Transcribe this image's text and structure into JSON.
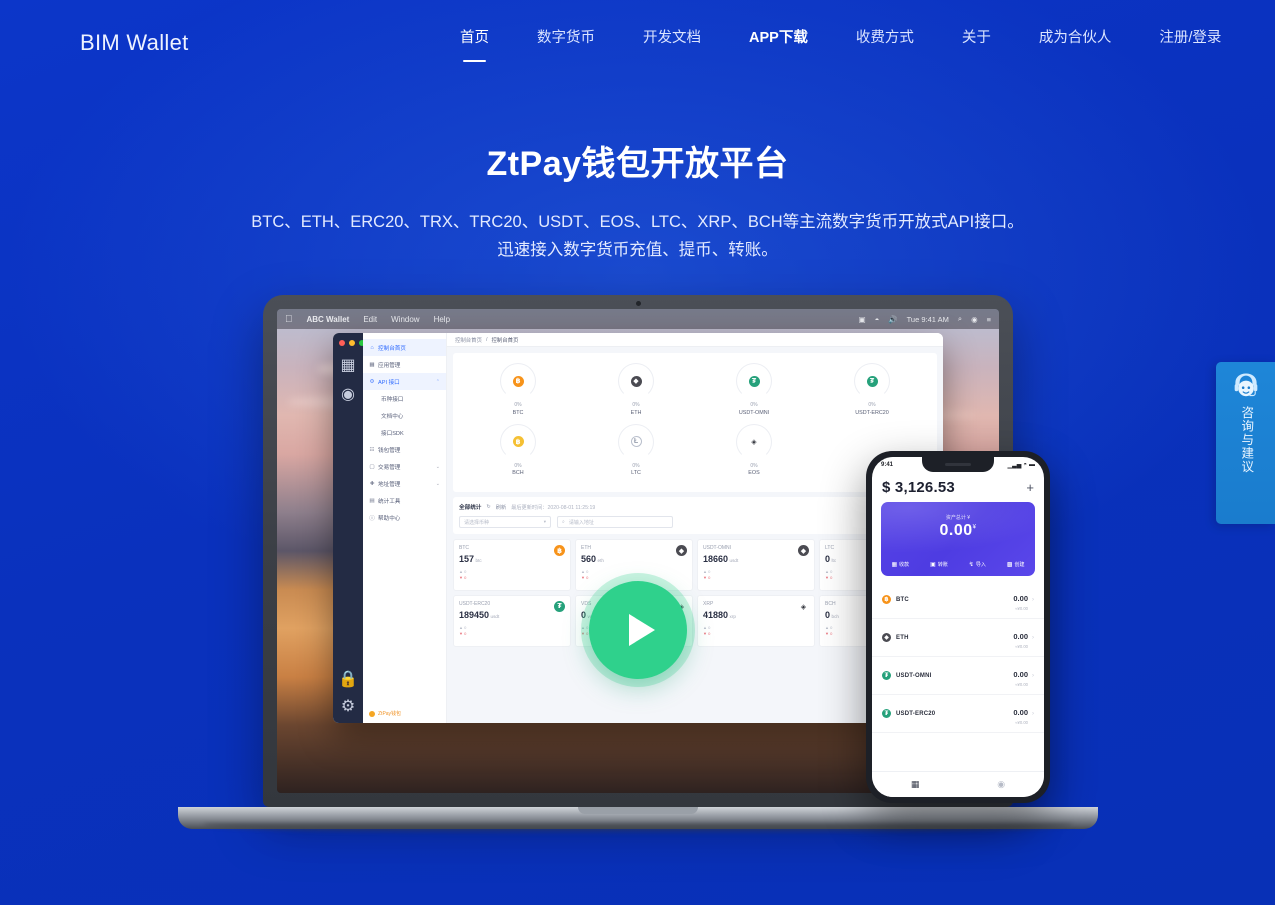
{
  "header": {
    "brand": "BIM Wallet",
    "nav": [
      {
        "label": "首页",
        "state": "active"
      },
      {
        "label": "数字货币",
        "state": "normal"
      },
      {
        "label": "开发文档",
        "state": "normal"
      },
      {
        "label": "APP下载",
        "state": "bold"
      },
      {
        "label": "收费方式",
        "state": "normal"
      },
      {
        "label": "关于",
        "state": "normal"
      },
      {
        "label": "成为合伙人",
        "state": "normal"
      },
      {
        "label": "注册/登录",
        "state": "normal"
      }
    ]
  },
  "hero": {
    "title": "ZtPay钱包开放平台",
    "sub_line1": "BTC、ETH、ERC20、TRX、TRC20、USDT、EOS、LTC、XRP、BCH等主流数字货币开放式API接口。",
    "sub_line2": "迅速接入数字货币充值、提币、转账。"
  },
  "play_button": {
    "name": "play-video-button"
  },
  "consult_widget": {
    "icon": "headset-support-icon",
    "text": "咨询与建议"
  },
  "laptop": {
    "macos_menubar": {
      "apple": "",
      "items": [
        "ABC Wallet",
        "Edit",
        "Window",
        "Help"
      ],
      "right": [
        "screen-icon",
        "wifi-icon",
        "volume-icon",
        "Tue 9:41 AM",
        "search-icon",
        "siri-icon",
        "controlcenter-icon"
      ]
    },
    "app": {
      "sidebar": [
        {
          "label": "控制台首页",
          "icon": "home-icon",
          "selected": true,
          "sub": false,
          "chevron": ""
        },
        {
          "label": "应用管理",
          "icon": "apps-icon",
          "selected": false,
          "sub": false,
          "chevron": ""
        },
        {
          "label": "API 接口",
          "icon": "api-icon",
          "selected": false,
          "sub": false,
          "chevron": "⌃",
          "highlight": true
        },
        {
          "label": "币种接口",
          "icon": "",
          "selected": false,
          "sub": true,
          "chevron": ""
        },
        {
          "label": "文档中心",
          "icon": "",
          "selected": false,
          "sub": true,
          "chevron": ""
        },
        {
          "label": "接口SDK",
          "icon": "",
          "selected": false,
          "sub": true,
          "chevron": ""
        },
        {
          "label": "钱包管理",
          "icon": "wallet-icon",
          "selected": false,
          "sub": false,
          "chevron": ""
        },
        {
          "label": "交易管理",
          "icon": "tx-icon",
          "selected": false,
          "sub": false,
          "chevron": "⌄"
        },
        {
          "label": "地址管理",
          "icon": "addr-icon",
          "selected": false,
          "sub": false,
          "chevron": "⌄"
        },
        {
          "label": "统计工具",
          "icon": "chart-icon",
          "selected": false,
          "sub": false,
          "chevron": ""
        },
        {
          "label": "帮助中心",
          "icon": "help-icon",
          "selected": false,
          "sub": false,
          "chevron": ""
        }
      ],
      "sidebar_logo": "ZtPay钱包",
      "breadcrumb": {
        "root": "控制台首页",
        "sep": "/",
        "current": "控制台首页"
      },
      "coin_gauges": [
        {
          "symbol": "BTC",
          "percent": "0%",
          "glyph": "฿",
          "style": "cb-btc"
        },
        {
          "symbol": "ETH",
          "percent": "0%",
          "glyph": "◆",
          "style": "cb-eth"
        },
        {
          "symbol": "USDT-OMNI",
          "percent": "0%",
          "glyph": "₮",
          "style": "cb-usdt"
        },
        {
          "symbol": "USDT-ERC20",
          "percent": "0%",
          "glyph": "₮",
          "style": "cb-usdt"
        },
        {
          "symbol": "BCH",
          "percent": "0%",
          "glyph": "฿",
          "style": "cb-bch"
        },
        {
          "symbol": "LTC",
          "percent": "0%",
          "glyph": "Ł",
          "style": "cb-ltc"
        },
        {
          "symbol": "EOS",
          "percent": "0%",
          "glyph": "◈",
          "style": "cb-eos"
        }
      ],
      "filter": {
        "title": "全部统计",
        "refresh": "刷新",
        "updated": "最后更新时间：2020-08-01 11:25:19",
        "select_placeholder": "请选择币种",
        "input_placeholder": "请输入地址",
        "search_icon": "search-icon"
      },
      "wallet_cards": [
        {
          "name": "BTC",
          "amount": "157",
          "unit": "btc",
          "style": "cb-btc",
          "glyph": "฿"
        },
        {
          "name": "ETH",
          "amount": "560",
          "unit": "eth",
          "style": "cb-eth",
          "glyph": "◆"
        },
        {
          "name": "USDT-OMNI",
          "amount": "18660",
          "unit": "usdt",
          "style": "cb-eth",
          "glyph": "◆"
        },
        {
          "name": "LTC",
          "amount": "0",
          "unit": "ltc",
          "style": "cb-ltc",
          "glyph": "Ł"
        },
        {
          "name": "USDT-ERC20",
          "amount": "189450",
          "unit": "usdt",
          "style": "cb-usdt",
          "glyph": "₮"
        },
        {
          "name": "VDS",
          "amount": "0",
          "unit": "vds",
          "style": "cb-eos",
          "glyph": "◈"
        },
        {
          "name": "XRP",
          "amount": "41880",
          "unit": "xrp",
          "style": "cb-eos",
          "glyph": "◈"
        },
        {
          "name": "BCH",
          "amount": "0",
          "unit": "bch",
          "style": "cb-bch",
          "glyph": "฿"
        }
      ],
      "card_sub_labels": {
        "in": "充值",
        "out": "提币"
      }
    }
  },
  "phone": {
    "status": {
      "time": "9:41",
      "signal": "signal-icon",
      "wifi": "wifi-icon",
      "battery": "battery-icon"
    },
    "balance": "$ 3,126.53",
    "add_icon": "plus-icon",
    "card": {
      "label": "资产总计 ¥",
      "amount": "0.00",
      "sup": "¥"
    },
    "actions": [
      {
        "label": "收款",
        "icon": "qrcode-icon"
      },
      {
        "label": "转账",
        "icon": "transfer-icon"
      },
      {
        "label": "导入",
        "icon": "import-icon"
      },
      {
        "label": "创建",
        "icon": "create-icon"
      }
    ],
    "coins": [
      {
        "name": "BTC",
        "value": "0.00",
        "fiat": "≈¥0.00",
        "style": "cb-btc",
        "glyph": "฿"
      },
      {
        "name": "ETH",
        "value": "0.00",
        "fiat": "≈¥0.00",
        "style": "cb-eth",
        "glyph": "◆"
      },
      {
        "name": "USDT-OMNI",
        "value": "0.00",
        "fiat": "≈¥0.00",
        "style": "cb-usdt",
        "glyph": "₮"
      },
      {
        "name": "USDT-ERC20",
        "value": "0.00",
        "fiat": "≈¥0.00",
        "style": "cb-usdt",
        "glyph": "₮"
      }
    ],
    "tabs": [
      {
        "icon": "wallet-tab-icon",
        "active": true
      },
      {
        "icon": "settings-tab-icon",
        "active": false
      }
    ]
  },
  "colors": {
    "background_blue": "#0a34c4",
    "accent_green": "#2fd18c",
    "consult_blue": "#1e86d8",
    "card_purple": "#5542e6",
    "btc_orange": "#f7931a",
    "usdt_green": "#26a17b"
  }
}
